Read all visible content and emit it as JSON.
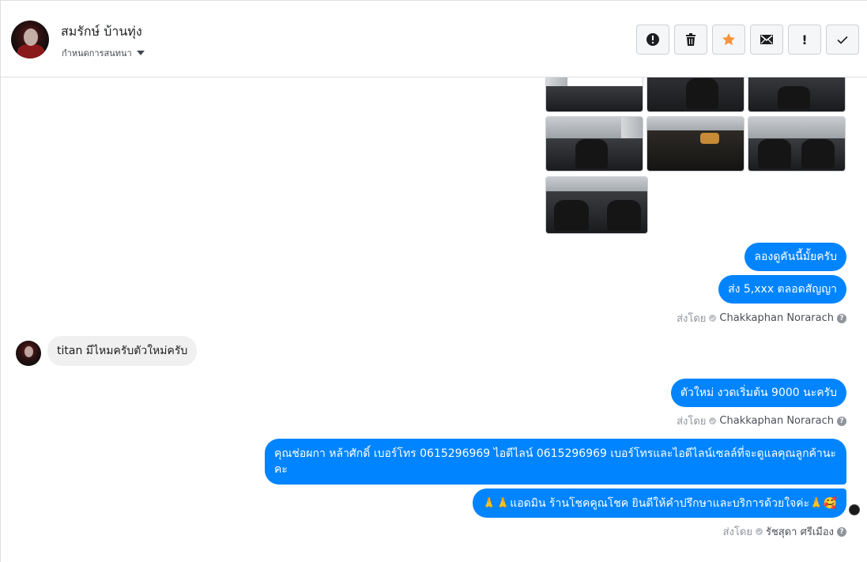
{
  "header": {
    "name": "สมรักษ์ บ้านทุ่ง",
    "assign_label": "กำหนดการสนทนา",
    "avatar_icon": "profile-photo"
  },
  "actions": [
    {
      "name": "report-button",
      "icon": "alert-circle-icon"
    },
    {
      "name": "delete-button",
      "icon": "trash-icon"
    },
    {
      "name": "star-button",
      "icon": "star-icon",
      "color": "#f7923b"
    },
    {
      "name": "mark-unread-button",
      "icon": "envelope-icon"
    },
    {
      "name": "mark-spam-button",
      "icon": "exclamation-icon",
      "label": "!"
    },
    {
      "name": "mark-done-button",
      "icon": "check-icon"
    }
  ],
  "messages": {
    "m1": "ลองดูคันนี้มั้ยครับ",
    "m2": "ส่ง 5,xxx ตลอดสัญญา",
    "m3": "titan มีไหมครับตัวใหม่ครับ",
    "m4": "ตัวใหม่ งวดเริ่มต้น 9000 นะครับ",
    "m5": "คุณช่อผกา หล้าศักดิ์       เบอร์โทร 0615296969  ไอดีไลน์ 0615296969   เบอร์โทรและไอดีไลน์เซลล์ที่จะดูแลคุณลูกค้านะคะ",
    "m6": "🙏🙏แอดมิน ร้านโชคคูณโชค ยินดีให้คำปรึกษาและบริการด้วยใจค่ะ🙏🥰"
  },
  "sent_by": {
    "label": "ส่งโดย",
    "agent1": "Chakkaphan Norarach",
    "agent2": "รัชสุดา ศรีเมือง",
    "help": "?"
  },
  "colors": {
    "bubble_out": "#0084ff",
    "bubble_in": "#f1f0f0",
    "star": "#f7923b"
  }
}
